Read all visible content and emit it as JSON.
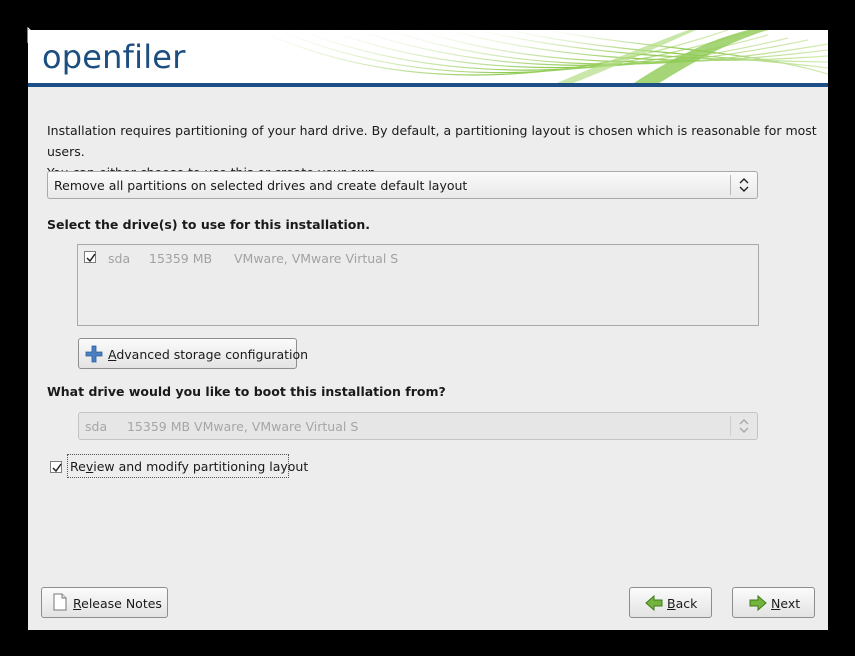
{
  "branding": {
    "logo_text": "openfiler"
  },
  "intro": {
    "line1": "Installation requires partitioning of your hard drive.  By default, a partitioning layout is chosen which is reasonable for most users.",
    "line2": "You can either choose to use this or create your own."
  },
  "layout_select": {
    "value": "Remove all partitions on selected drives and create default layout"
  },
  "drives": {
    "label": "Select the drive(s) to use for this installation.",
    "items": [
      {
        "checked": true,
        "name": "sda",
        "size": "15359 MB",
        "model": "VMware, VMware Virtual S"
      }
    ]
  },
  "advanced_button": {
    "prefix": "",
    "accel": "A",
    "rest": "dvanced storage configuration"
  },
  "boot": {
    "label": "What drive would you like to boot this installation from?",
    "value": "sda     15359 MB VMware, VMware Virtual S"
  },
  "review_checkbox": {
    "checked": true,
    "prefix": "Re",
    "accel": "v",
    "rest": "iew and modify partitioning layout"
  },
  "buttons": {
    "release_notes": {
      "accel": "R",
      "rest": "elease Notes"
    },
    "back": {
      "accel": "B",
      "rest": "ack"
    },
    "next": {
      "accel": "N",
      "rest": "ext"
    }
  },
  "colors": {
    "brand_blue": "#1d4f86",
    "swoosh_green": "#7cc242",
    "window_bg": "#ededed"
  }
}
